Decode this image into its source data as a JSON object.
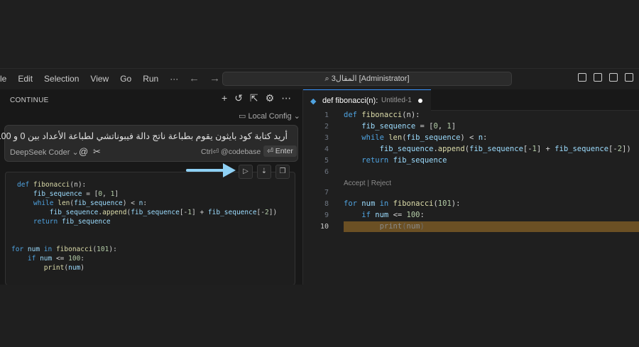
{
  "menu": [
    "le",
    "Edit",
    "Selection",
    "View",
    "Go",
    "Run",
    "···"
  ],
  "nav": {
    "back": "←",
    "forward": "→"
  },
  "command_center": "المقال3 [Administrator]",
  "chat_panel": {
    "title": "CONTINUE",
    "actions": [
      "+",
      "↺",
      "⇱",
      "⚙",
      "⋯"
    ],
    "config": "Local Config",
    "prompt": "أريد كتابة كود بايثون يقوم بطباعة ناتج دالة فيبوناتشي لطباعة الأعداد بين 0 و 100.",
    "model": "DeepSeek Coder",
    "at_symbol": "@",
    "ctrl_hint": "Ctrl⏎ @codebase",
    "enter": "⏎ Enter",
    "code_tools": [
      "▷",
      "⇣",
      "❐"
    ],
    "code_lines": [
      "def fibonacci(n):",
      "    fib_sequence = [0, 1]",
      "    while len(fib_sequence) < n:",
      "        fib_sequence.append(fib_sequence[-1] + fib_sequence[-2])",
      "    return fib_sequence",
      "",
      "",
      "for num in fibonacci(101):",
      "    if num <= 100:",
      "        print(num)"
    ]
  },
  "editor": {
    "tab_title": "def fibonacci(n):",
    "tab_subtitle": "Untitled-1",
    "accept_reject": "Accept | Reject",
    "line_numbers": [
      "1",
      "2",
      "3",
      "4",
      "5",
      "6",
      "7",
      "8",
      "9",
      "10"
    ],
    "active_line": "10"
  },
  "colors": {
    "accent_arrow": "#8fd1f5",
    "highlight": "#6b5024",
    "keyword": "#4fa3e0"
  }
}
